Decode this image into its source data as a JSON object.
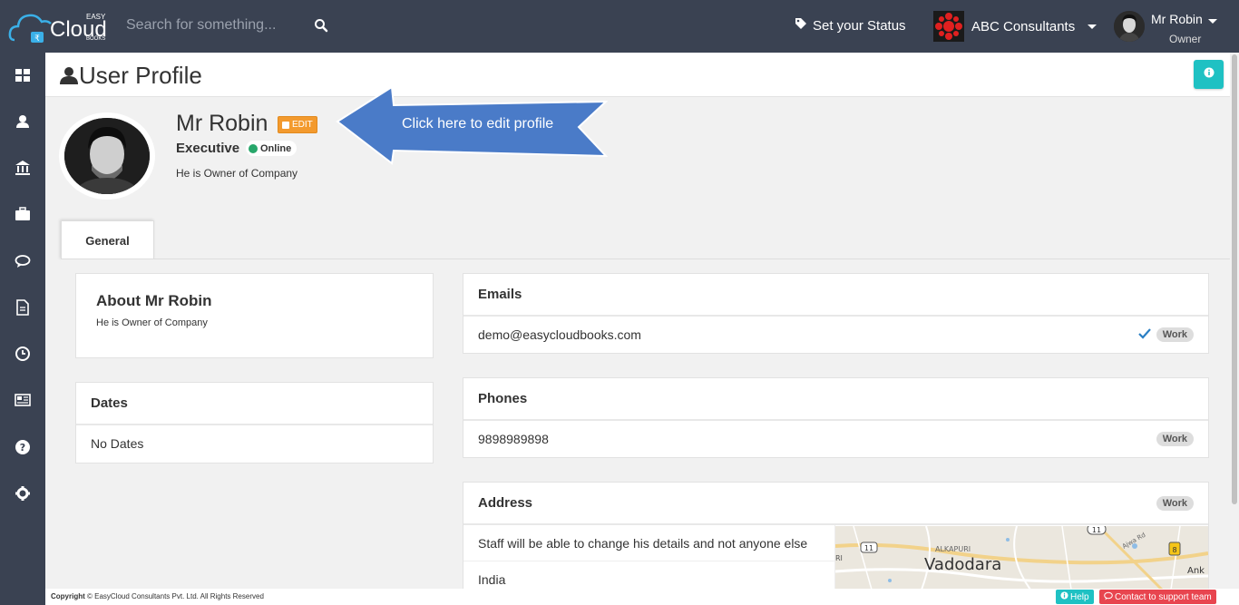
{
  "topbar": {
    "logo_easy": "EASY",
    "logo_cloud": "Cloud",
    "logo_books": "BOOKS",
    "search_placeholder": "Search for something...",
    "status_label": "Set your Status",
    "company_name": "ABC Consultants",
    "user_name": "Mr Robin",
    "user_role": "Owner"
  },
  "sidebar": {
    "items": [
      "dashboard-icon",
      "user-icon",
      "bank-icon",
      "briefcase-icon",
      "comments-icon",
      "document-icon",
      "clock-icon",
      "newspaper-icon",
      "help-icon",
      "settings-icon"
    ]
  },
  "page": {
    "title": "User Profile"
  },
  "profile": {
    "name": "Mr Robin",
    "edit_label": "EDIT",
    "position": "Executive",
    "status": "Online",
    "tagline": "He is Owner of Company",
    "callout": "Click here to edit profile"
  },
  "tabs": {
    "general": "General"
  },
  "about": {
    "title": "About Mr Robin",
    "text": "He is Owner of Company"
  },
  "dates": {
    "title": "Dates",
    "empty": "No Dates"
  },
  "emails": {
    "title": "Emails",
    "value": "demo@easycloudbooks.com",
    "type": "Work"
  },
  "phones": {
    "title": "Phones",
    "value": "9898989898",
    "type": "Work"
  },
  "address": {
    "title": "Address",
    "type": "Work",
    "line1": "Staff will be able to change his details and not anyone else",
    "line2": "India",
    "map_city": "Vadodara",
    "map_area": "ALKAPURI",
    "map_road": "Ajwa Rd",
    "map_partial": "Ank",
    "map_left_partial": "RI",
    "map_shield_1": "11",
    "map_shield_2": "11",
    "map_shield_3": "8"
  },
  "footer": {
    "copyright_bold": "Copyright",
    "copyright_text": "© EasyCloud Consultants Pvt. Ltd. All Rights Reserved",
    "help": "Help",
    "support": "Contact to support team"
  },
  "colors": {
    "topbar": "#3a4252",
    "accent_teal": "#1fc1c3",
    "edit_orange": "#f39a2e",
    "online_green": "#28a76b",
    "callout_blue": "#4a7bc8",
    "support_red": "#e8454f"
  }
}
